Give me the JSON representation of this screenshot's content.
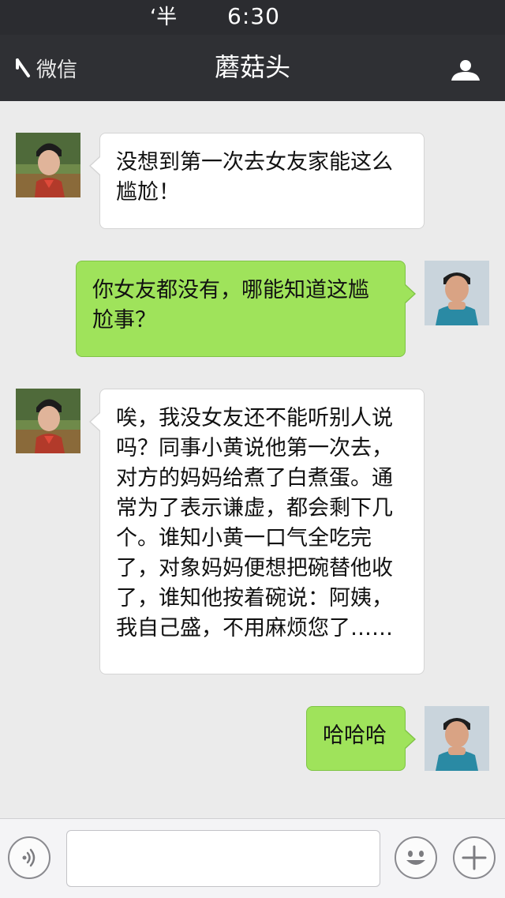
{
  "status_bar": {
    "carrier": "‘半",
    "time": "6:30"
  },
  "nav": {
    "back_label": "微信",
    "title": "蘑菇头"
  },
  "messages": [
    {
      "from": "friend",
      "text": "没想到第一次去女友家能这么尴尬！"
    },
    {
      "from": "me",
      "text": "你女友都没有，哪能知道这尴尬事？"
    },
    {
      "from": "friend",
      "text": "唉，我没女友还不能听别人说吗？同事小黄说他第一次去，对方的妈妈给煮了白煮蛋。通常为了表示谦虚，都会剩下几个。谁知小黄一口气全吃完了，对象妈妈便想把碗替他收了，谁知他按着碗说：阿姨，我自己盛，不用麻烦您了……"
    },
    {
      "from": "me",
      "text": "哈哈哈"
    }
  ],
  "input": {
    "value": "",
    "placeholder": ""
  },
  "icons": {
    "back": "back-arrow-icon",
    "profile": "person-icon",
    "voice": "voice-icon",
    "emoji": "emoji-icon",
    "more": "plus-icon"
  },
  "colors": {
    "nav_background": "#2f3034",
    "chat_background": "#ebebeb",
    "incoming_bubble": "#ffffff",
    "outgoing_bubble": "#9fe35b"
  }
}
